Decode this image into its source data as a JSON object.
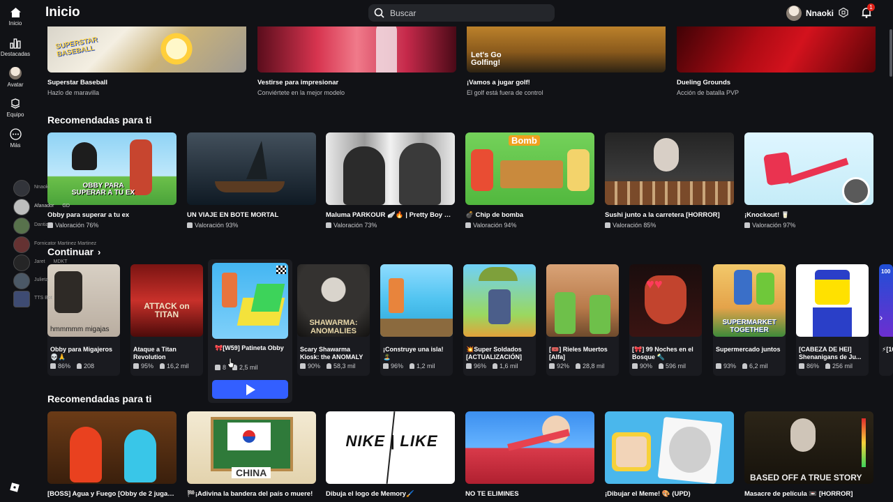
{
  "header": {
    "title": "Inicio",
    "search_placeholder": "Buscar",
    "username": "Nnaoki",
    "notification_count": "1"
  },
  "sidebar": {
    "items": [
      {
        "label": "Inicio",
        "icon": "home-icon"
      },
      {
        "label": "Destacadas",
        "icon": "charts-icon"
      },
      {
        "label": "Avatar",
        "icon": "avatar-icon"
      },
      {
        "label": "Equipo",
        "icon": "inventory-icon"
      },
      {
        "label": "Más",
        "icon": "more-icon"
      }
    ],
    "friends": [
      {
        "name": "Nnaoki"
      },
      {
        "name": "Afanador",
        "badge": "GD"
      },
      {
        "name": "Dantia"
      },
      {
        "name": "Fornicator Martinez Martinez"
      },
      {
        "name": "Jaret",
        "badge": "MDKT"
      },
      {
        "name": "Julieta"
      },
      {
        "name": "TTS Bot"
      }
    ]
  },
  "top_row": [
    {
      "title": "Superstar Baseball",
      "subtitle": "Hazlo de maravilla"
    },
    {
      "title": "Vestirse para impresionar",
      "subtitle": "Conviértete en la mejor modelo"
    },
    {
      "title": "¡Vamos a jugar golf!",
      "subtitle": "El golf está fuera de control"
    },
    {
      "title": "Dueling Grounds",
      "subtitle": "Acción de batalla PVP"
    }
  ],
  "recommended_1": {
    "title": "Recomendadas para ti",
    "items": [
      {
        "title": "Obby para superar a tu ex",
        "rating": "Valoración 76%"
      },
      {
        "title": "UN VIAJE EN BOTE MORTAL",
        "rating": "Valoración 93%"
      },
      {
        "title": "Maluma PARKOUR 🪽🔥 | Pretty Boy Ed...",
        "rating": "Valoración 73%"
      },
      {
        "title": "💣 Chip de bomba",
        "rating": "Valoración 94%"
      },
      {
        "title": "Sushi junto a la carretera [HORROR]",
        "rating": "Valoración 85%"
      },
      {
        "title": "¡Knockout! 🥛",
        "rating": "Valoración 97%"
      }
    ]
  },
  "continue": {
    "title": "Continuar",
    "items": [
      {
        "title": "Obby para Migajeros 💀🙏",
        "rating": "86%",
        "players": "208"
      },
      {
        "title": "Ataque a Titan Revolution",
        "rating": "95%",
        "players": "16,2 mil"
      },
      {
        "title": "🎀[W59] Patineta Obby",
        "rating": "8",
        "players": "2,5 mil"
      },
      {
        "title": "Scary Shawarma Kiosk: the ANOMALY",
        "rating": "90%",
        "players": "58,3 mil"
      },
      {
        "title": "¡Construye una isla! 🏝️",
        "rating": "96%",
        "players": "1,2 mil"
      },
      {
        "title": "💥Super Soldados [ACTUALIZACIÓN]",
        "rating": "96%",
        "players": "1,6 mil"
      },
      {
        "title": "[🎟️] Rieles Muertos [Alfa]",
        "rating": "92%",
        "players": "28,8 mil"
      },
      {
        "title": "[🎀] 99 Noches en el Bosque 🔦",
        "rating": "90%",
        "players": "596 mil"
      },
      {
        "title": "Supermercado juntos",
        "rating": "93%",
        "players": "6,2 mil"
      },
      {
        "title": "[CABEZA DE HEI] Shenanigans de Ju...",
        "rating": "86%",
        "players": "256 mil"
      },
      {
        "title": "⚡[10",
        "rating": "",
        "players": ""
      }
    ],
    "thumb_texts": [
      "hmmmmm migajas",
      "ATTACK on TITAN",
      "",
      "SHAWARMA: ANOMALIES",
      "",
      "",
      "",
      "",
      "SUPERMARKET TOGETHER",
      "",
      "100"
    ]
  },
  "recommended_2": {
    "title": "Recomendadas para ti",
    "items": [
      {
        "title": "[BOSS] Agua y Fuego [Obby de 2 jugad..."
      },
      {
        "title": "🏁¡Adivina la bandera del país o muere!"
      },
      {
        "title": "Dibuja el logo de Memory🖌️"
      },
      {
        "title": "NO TE ELIMINES"
      },
      {
        "title": "¡Dibujar el Meme! 🎨 (UPD)"
      },
      {
        "title": "Masacre de película 📼 [HORROR]"
      }
    ],
    "thumb_texts": [
      "",
      "CHINA",
      "NIKE | LIKE",
      "",
      "",
      "BASED OFF A TRUE STORY"
    ]
  },
  "thumb_labels": {
    "baseball": "SUPERSTAR BASEBALL",
    "golf": "Let's Go Golfing!",
    "obby_ex": "OBBY PARA SUPERAR A TU EX",
    "bomb": "Bomb"
  },
  "colors": {
    "background": "#111216",
    "play_button": "#335fff",
    "notification": "#e2231a"
  }
}
